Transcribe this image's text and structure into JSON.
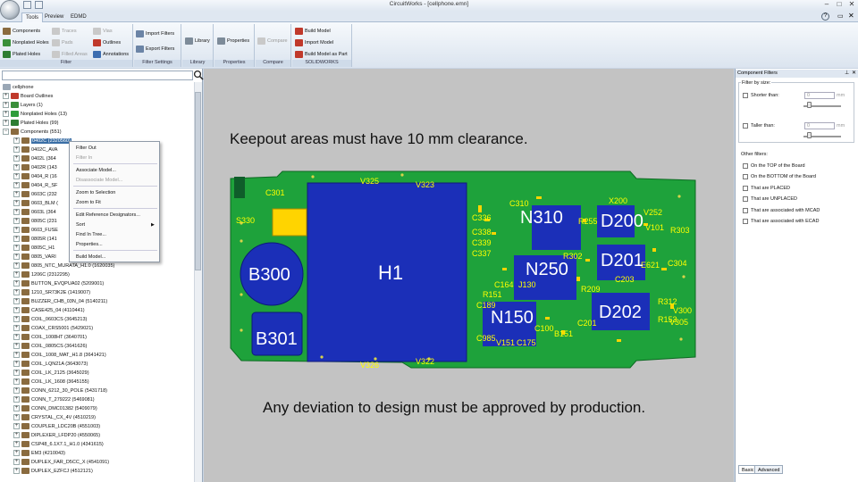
{
  "window": {
    "title": "CircuitWorks - [cellphone.emn]"
  },
  "tabs": [
    "Tools",
    "Preview",
    "EDMD"
  ],
  "active_tab": "Tools",
  "ribbon": {
    "filter": {
      "label": "Filter",
      "components": "Components",
      "traces": "Traces",
      "vias": "Vias",
      "nonplated": "Nonplated Holes",
      "pads": "Pads",
      "outlines": "Outlines",
      "plated": "Plated Holes",
      "filled": "Filled Areas",
      "annotations": "Annotations"
    },
    "filter_settings": {
      "label": "Filter Settings",
      "import": "Import Filters",
      "export": "Export Filters"
    },
    "library": {
      "label": "Library",
      "button": "Library"
    },
    "properties": {
      "label": "Properties",
      "button": "Properties"
    },
    "compare": {
      "label": "Compare",
      "button": "Compare"
    },
    "solidworks": {
      "label": "SOLIDWORKS",
      "build": "Build Model",
      "import": "Import Model",
      "build_part": "Build Model as Part"
    }
  },
  "tree": {
    "root": "cellphone",
    "items": [
      "Board Outlines",
      "Layers (1)",
      "Nonplated Holes (13)",
      "Plated Holes (99)",
      "Components (551)"
    ],
    "components": [
      "0402C (2320560)",
      "0402C_AVA",
      "0402L (364",
      "0402R (143",
      "0404_R (16",
      "0404_R_SF",
      "0603C (232",
      "0603_BLM (",
      "0603L (364",
      "0805C (231",
      "0603_FUSE",
      "0805R (141",
      "0805C_H1",
      "0805_VARI",
      "0805_NTC_MURATA_H1.0 (1620035)",
      "1206C (2312295)",
      "BUTTON_EVQPUA02 (5209001)",
      "1210_SR73K2E (1419007)",
      "BUZZER_CHB_03N_04 (5140211)",
      "CASE425_04 (4110441)",
      "COIL_0603CS (3645213)",
      "COAX_CRS5001 (5429021)",
      "COIL_1008HT (3640701)",
      "COIL_0805CS (3641626)",
      "COIL_1008_MAT_H1.8 (3641421)",
      "COIL_LQN21A (3643073)",
      "COIL_LK_2125 (3645029)",
      "COIL_LK_1608 (3645155)",
      "CONN_6212_30_POLE (5431718)",
      "CONN_T_279222 (5469081)",
      "CONN_DMC01382 (5409079)",
      "CRYSTAL_CX_4V (4510219)",
      "COUPLER_LDC20B (4551003)",
      "DIPLEXER_LFDP20 (4550065)",
      "CSP48_6.1X7.1_H1.0 (4341615)",
      "EM3 (4210043)",
      "DUPLEX_FAR_D5CC_X (4541091)",
      "DUPLEX_EZFCJ (4512121)"
    ]
  },
  "context_menu": [
    "Filter Out",
    "Filter In",
    "Associate Model...",
    "Disassociate Model...",
    "Zoom to Selection",
    "Zoom to Fit",
    "Edit Reference Designators...",
    "Sort",
    "Find In Tree...",
    "Properties...",
    "Build Model..."
  ],
  "canvas": {
    "note_top": "Keepout areas must have 10 mm clearance.",
    "note_bottom": "Any deviation to design must be approved by production.",
    "big_labels": [
      "H1",
      "B300",
      "B301",
      "N310",
      "N250",
      "N150",
      "D200",
      "D201",
      "D202"
    ],
    "small_labels": [
      "V325",
      "V323",
      "S330",
      "V326",
      "V322",
      "X200",
      "C336",
      "C338",
      "C339",
      "C337",
      "V252",
      "V101",
      "R312",
      "V300",
      "R153",
      "C203",
      "C189",
      "C985",
      "V151",
      "C175",
      "E621",
      "C304",
      "C164",
      "J130",
      "C100",
      "R151",
      "C201",
      "B151",
      "R209",
      "V305",
      "R303",
      "C310",
      "C301",
      "R302",
      "R255"
    ]
  },
  "right_panel": {
    "title": "Component Filters",
    "filter_by_size": "Filter by size:",
    "shorter": "Shorter than:",
    "taller": "Taller than:",
    "value": "0",
    "unit": "mm",
    "other": "Other filters:",
    "options": [
      "On the TOP of the Board",
      "On the BOTTOM of the Board",
      "That are PLACED",
      "That are UNPLACED",
      "That are associated with MCAD",
      "That are associated with ECAD"
    ],
    "tabs": [
      "Basic",
      "Advanced"
    ]
  }
}
